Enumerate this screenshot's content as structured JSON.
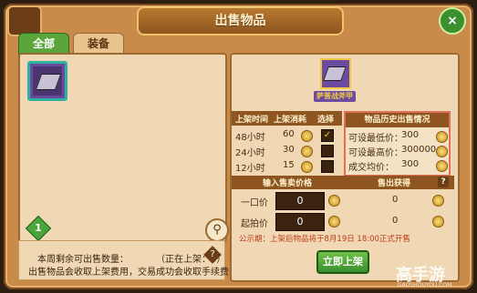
{
  "window": {
    "title": "出售物品",
    "close_label": "×"
  },
  "tabs": [
    {
      "label": "全部"
    },
    {
      "label": "装备"
    }
  ],
  "left": {
    "badge": "1",
    "search_icon": "magnifier-icon",
    "note_remaining": "本周剩余可出售数量：",
    "note_listed": "（正在上架：0）",
    "note_help": "?",
    "note_fee": "出售物品会收取上架费用，交易成功会收取手续费"
  },
  "item": {
    "name": "萨普战斧甲"
  },
  "listing": {
    "headers": [
      "上架时间",
      "上架消耗",
      "选择"
    ],
    "rows": [
      {
        "time": "48小时",
        "cost": "60",
        "checked": "✓"
      },
      {
        "time": "24小时",
        "cost": "30",
        "checked": ""
      },
      {
        "time": "12小时",
        "cost": "15",
        "checked": ""
      }
    ]
  },
  "history": {
    "title": "物品历史出售情况",
    "rows": [
      {
        "label": "可设最低价：",
        "value": "300"
      },
      {
        "label": "可设最高价：",
        "value": "300000"
      },
      {
        "label": "成交均价：",
        "value": "300"
      }
    ]
  },
  "pricing": {
    "header_input": "输入售卖价格",
    "header_output": "售出获得",
    "help": "?",
    "rows": [
      {
        "label": "一口价",
        "value": "0",
        "gain": "0"
      },
      {
        "label": "起拍价",
        "value": "0",
        "gain": "0"
      }
    ]
  },
  "notice": "公示期：上架后物品将于8月19日 18:00正式开售",
  "sell_button": "立即上架",
  "watermark": {
    "text": "高手游",
    "sub": "GAOSHOUYOU.COM"
  }
}
